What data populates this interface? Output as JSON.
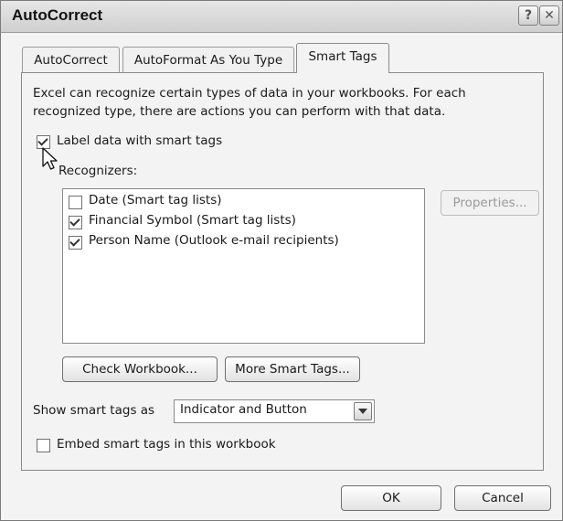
{
  "window": {
    "title": "AutoCorrect",
    "help_glyph": "?",
    "close_glyph": "✕"
  },
  "tabs": [
    {
      "label": "AutoCorrect"
    },
    {
      "label": "AutoFormat As You Type"
    },
    {
      "label": "Smart Tags",
      "selected": true
    }
  ],
  "description": {
    "line1": "Excel can recognize certain types of data in your workbooks.  For each",
    "line2": "recognized type, there are actions you can perform with that data."
  },
  "label_checkbox": {
    "label": "Label data with smart tags",
    "checked": true
  },
  "recognizers": {
    "label": "Recognizers:",
    "items": [
      {
        "label": "Date (Smart tag lists)",
        "checked": false
      },
      {
        "label": "Financial Symbol (Smart tag lists)",
        "checked": true
      },
      {
        "label": "Person Name (Outlook e-mail recipients)",
        "checked": true
      }
    ]
  },
  "buttons": {
    "properties": "Properties...",
    "check_workbook": "Check Workbook...",
    "more_smart_tags": "More Smart Tags...",
    "ok": "OK",
    "cancel": "Cancel"
  },
  "show_as": {
    "label": "Show smart tags as",
    "value": "Indicator and Button"
  },
  "embed_checkbox": {
    "label": "Embed smart tags in this workbook",
    "checked": false
  },
  "colors": {
    "dialog_bg": "#f3f3f3",
    "disabled_text": "#9a9a9a"
  },
  "icons": {
    "pointer": "mouse-pointer-icon",
    "dropdown": "chevron-down-icon"
  }
}
